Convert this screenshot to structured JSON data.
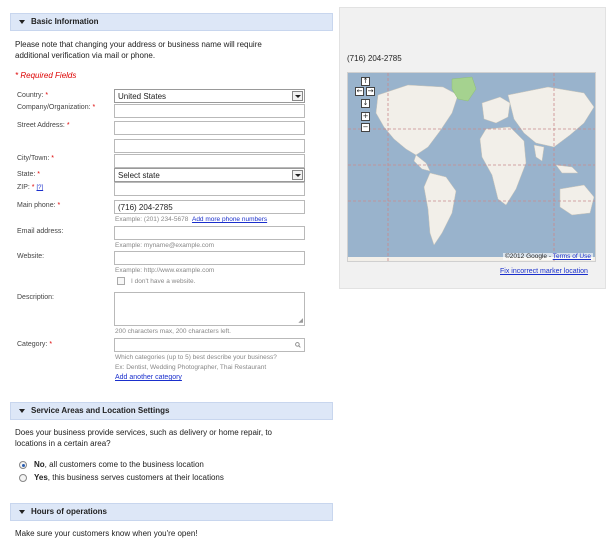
{
  "sections": {
    "basic": {
      "title": "Basic Information"
    },
    "service": {
      "title": "Service Areas and Location Settings"
    },
    "hours": {
      "title": "Hours of operations"
    }
  },
  "notice": {
    "line1": "Please note that changing your address or business name will require",
    "line2": "additional verification via mail or phone."
  },
  "required_note": "* Required Fields",
  "form": {
    "country": {
      "label": "Country:",
      "value": "United States"
    },
    "company": {
      "label": "Company/Organization:",
      "value": ""
    },
    "street": {
      "label": "Street Address:",
      "value": ""
    },
    "city": {
      "label": "City/Town:",
      "value": ""
    },
    "state": {
      "label": "State:",
      "value": "Select state"
    },
    "zip": {
      "label": "ZIP:",
      "help": "[?]",
      "value": ""
    },
    "phone": {
      "label": "Main phone:",
      "value": "(716) 204-2785",
      "hint": "Example: (201) 234-5678",
      "add_link": "Add more phone numbers"
    },
    "email": {
      "label": "Email address:",
      "value": "",
      "hint": "Example: myname@example.com"
    },
    "website": {
      "label": "Website:",
      "value": "",
      "hint": "Example: http://www.example.com",
      "no_site": "I don't have a website."
    },
    "description": {
      "label": "Description:",
      "value": "",
      "hint": "200 characters max, 200 characters left."
    },
    "category": {
      "label": "Category:",
      "value": "",
      "hint1": "Which categories (up to 5) best describe your business?",
      "hint2": "Ex: Dentist, Wedding Photographer, Thai Restaurant",
      "add_link": "Add another category"
    },
    "required_mark": "*"
  },
  "service": {
    "question1": "Does your business provide services, such as delivery or home repair, to",
    "question2": "locations in a certain area?",
    "option_no_bold": "No",
    "option_no_rest": ", all customers come to the business location",
    "option_yes_bold": "Yes",
    "option_yes_rest": ", this business serves customers at their locations"
  },
  "hours": {
    "text": "Make sure your customers know when you're open!"
  },
  "map": {
    "phone": "(716) 204-2785",
    "copyright": "©2012 Google - ",
    "terms": "Terms of Use",
    "fix_link": "Fix incorrect marker location",
    "nav": {
      "up": "↑",
      "left": "←",
      "right": "→",
      "down": "↓",
      "zoom_in": "+",
      "zoom_out": "−"
    },
    "colors": {
      "water": "#99b3cc",
      "land": "#f2efe9",
      "greenland": "#a5d28f",
      "tropic": "#c98a8a"
    }
  }
}
